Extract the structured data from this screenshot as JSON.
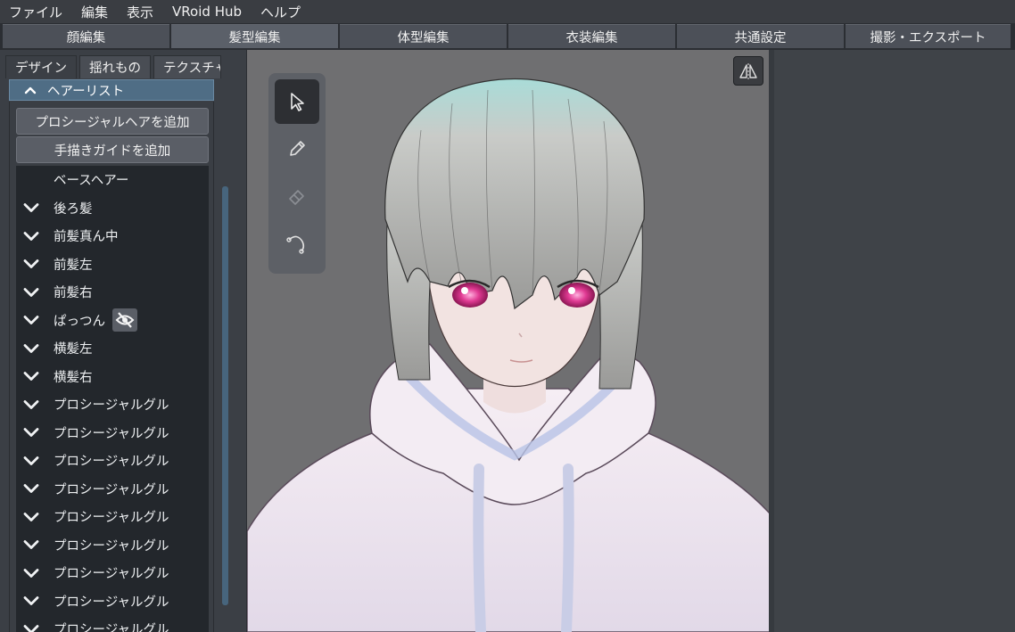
{
  "menu": [
    "ファイル",
    "編集",
    "表示",
    "VRoid Hub",
    "ヘルプ"
  ],
  "main_tabs": [
    "顔編集",
    "髪型編集",
    "体型編集",
    "衣装編集",
    "共通設定",
    "撮影・エクスポート"
  ],
  "active_main_tab": "髪型編集",
  "sub_tabs": [
    "デザイン",
    "揺れもの",
    "テクスチャ"
  ],
  "section": {
    "title": "ヘアーリスト"
  },
  "buttons": {
    "add_procedural": "プロシージャルヘアを追加",
    "add_guide": "手描きガイドを追加"
  },
  "hair_list": [
    {
      "label": "ベースヘアー",
      "expand": false
    },
    {
      "label": "後ろ髪",
      "expand": true
    },
    {
      "label": "前髪真ん中",
      "expand": true
    },
    {
      "label": "前髪左",
      "expand": true
    },
    {
      "label": "前髪右",
      "expand": true
    },
    {
      "label": "ぱっつん",
      "expand": true,
      "hidden_icon": "eye-off-icon"
    },
    {
      "label": "横髪左",
      "expand": true
    },
    {
      "label": "横髪右",
      "expand": true
    },
    {
      "label": "プロシージャルグル",
      "expand": true
    },
    {
      "label": "プロシージャルグル",
      "expand": true
    },
    {
      "label": "プロシージャルグル",
      "expand": true
    },
    {
      "label": "プロシージャルグル",
      "expand": true
    },
    {
      "label": "プロシージャルグル",
      "expand": true
    },
    {
      "label": "プロシージャルグル",
      "expand": true
    },
    {
      "label": "プロシージャルグル",
      "expand": true
    },
    {
      "label": "プロシージャルグル",
      "expand": true
    },
    {
      "label": "プロシージャルグル",
      "expand": true
    }
  ],
  "tools": [
    "select-cursor-icon",
    "pencil-icon",
    "eraser-icon",
    "smooth-curve-icon"
  ],
  "colors": {
    "accent": "#4f6d85",
    "viewport_bg": "#6f6f71",
    "hair": "#c9c9c7",
    "eye": "#e03a93",
    "hoodie": "#efe8ef"
  }
}
